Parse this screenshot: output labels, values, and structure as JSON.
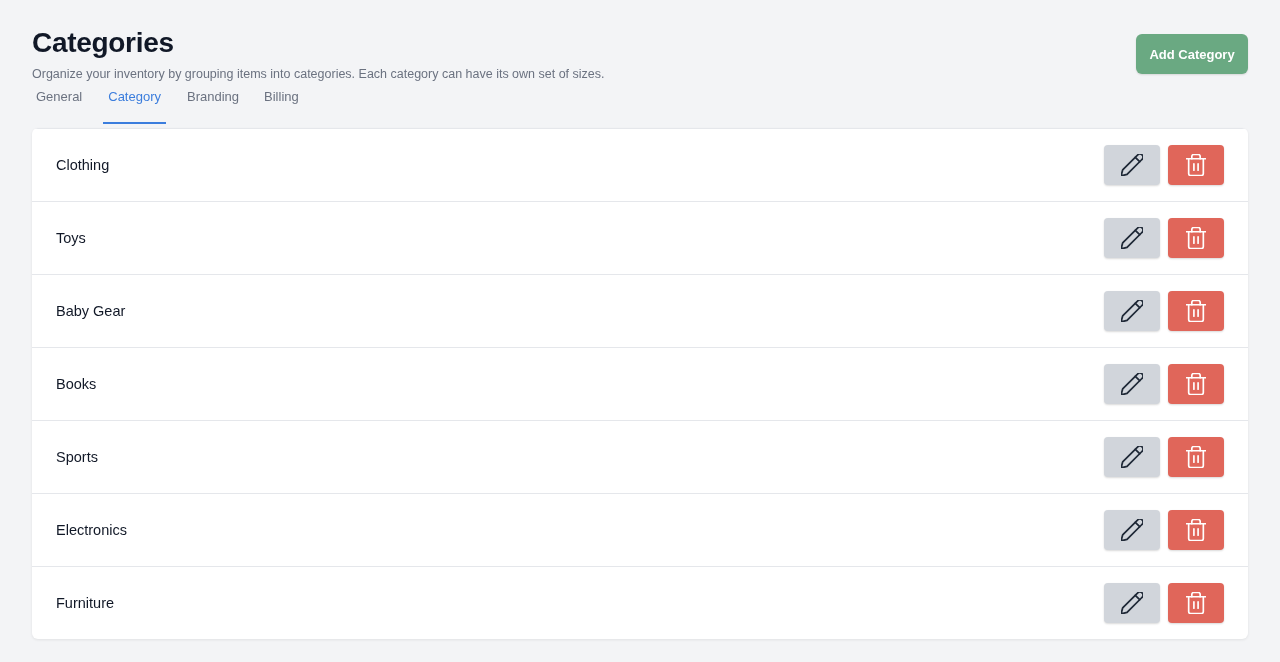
{
  "header": {
    "title": "Categories",
    "subtitle": "Organize your inventory by grouping items into categories. Each category can have its own set of sizes.",
    "add_button": "Add Category"
  },
  "tabs": [
    {
      "label": "General",
      "selected": false
    },
    {
      "label": "Category",
      "selected": true
    },
    {
      "label": "Branding",
      "selected": false
    },
    {
      "label": "Billing",
      "selected": false
    }
  ],
  "categories": [
    {
      "name": "Clothing"
    },
    {
      "name": "Toys"
    },
    {
      "name": "Baby Gear"
    },
    {
      "name": "Books"
    },
    {
      "name": "Sports"
    },
    {
      "name": "Electronics"
    },
    {
      "name": "Furniture"
    }
  ]
}
